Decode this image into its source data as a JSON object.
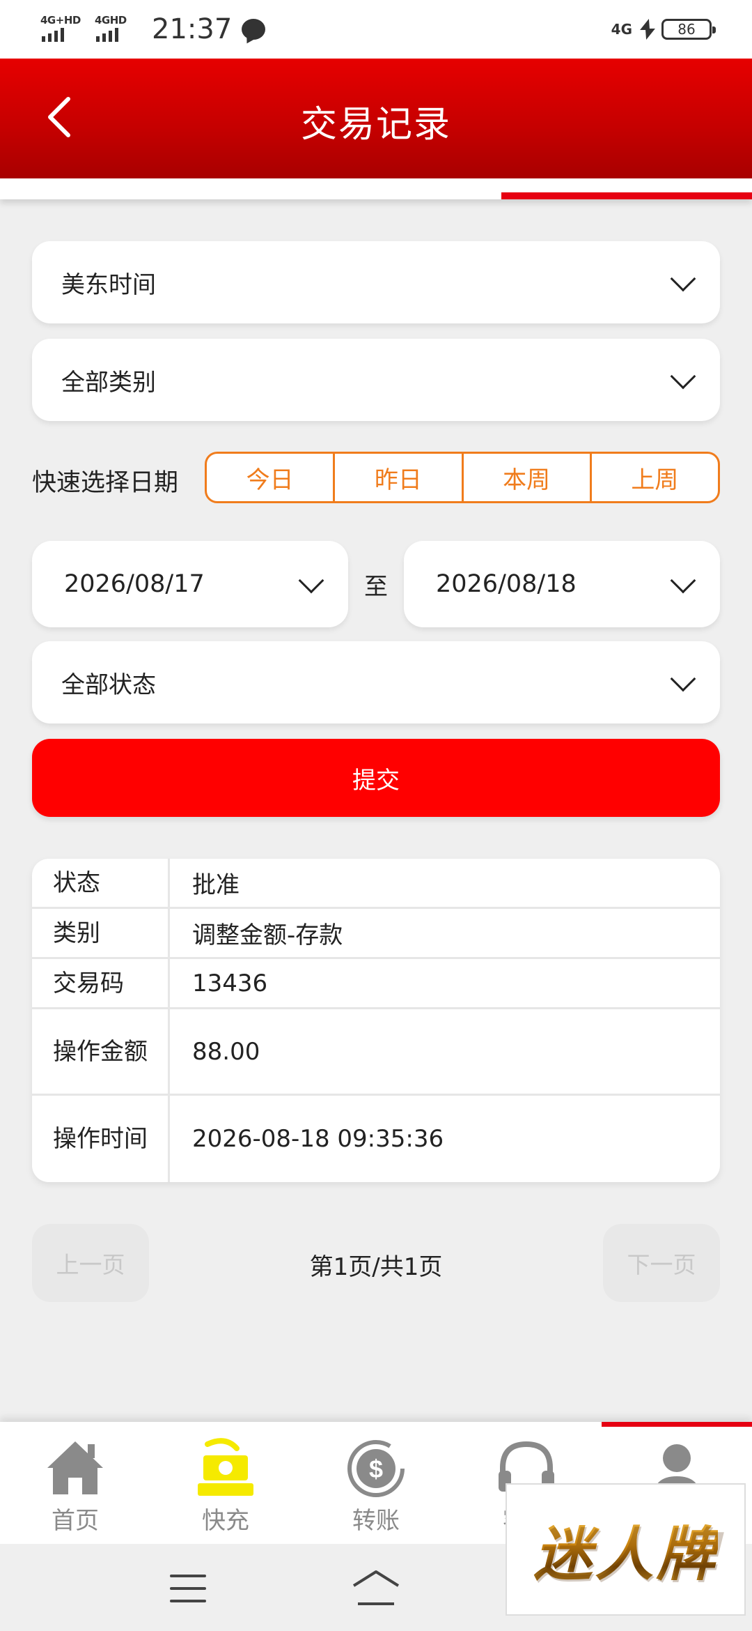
{
  "status_bar": {
    "net1": "4G+HD",
    "net2": "4GHD",
    "time": "21:37",
    "net_right": "4G",
    "battery": "86"
  },
  "header": {
    "title": "交易记录"
  },
  "filters": {
    "timezone": "美东时间",
    "category": "全部类别",
    "quick_label": "快速选择日期",
    "quick_options": [
      "今日",
      "昨日",
      "本周",
      "上周"
    ],
    "date_from": "2026/08/17",
    "date_sep": "至",
    "date_to": "2026/08/18",
    "status": "全部状态",
    "submit": "提交"
  },
  "record": {
    "rows": [
      {
        "label": "状态",
        "value": "批准"
      },
      {
        "label": "类别",
        "value": "调整金额-存款"
      },
      {
        "label": "交易码",
        "value": "13436"
      },
      {
        "label": "操作金额",
        "value": "88.00"
      },
      {
        "label": "操作时间",
        "value": "2026-08-18 09:35:36"
      }
    ]
  },
  "pagination": {
    "prev": "上一页",
    "info": "第1页/共1页",
    "next": "下一页"
  },
  "tabbar": {
    "items": [
      {
        "label": "首页",
        "icon": "home-icon"
      },
      {
        "label": "快充",
        "icon": "cash-icon"
      },
      {
        "label": "转账",
        "icon": "transfer-icon"
      },
      {
        "label": "客服",
        "icon": "headset-icon"
      },
      {
        "label": "我的",
        "icon": "user-icon"
      }
    ]
  },
  "watermark": {
    "text": "迷人牌"
  },
  "colors": {
    "brand_red": "#e60000",
    "submit_red": "#ff0000",
    "quick_orange": "#f07c1c",
    "cash_yellow": "#f5ea00"
  }
}
